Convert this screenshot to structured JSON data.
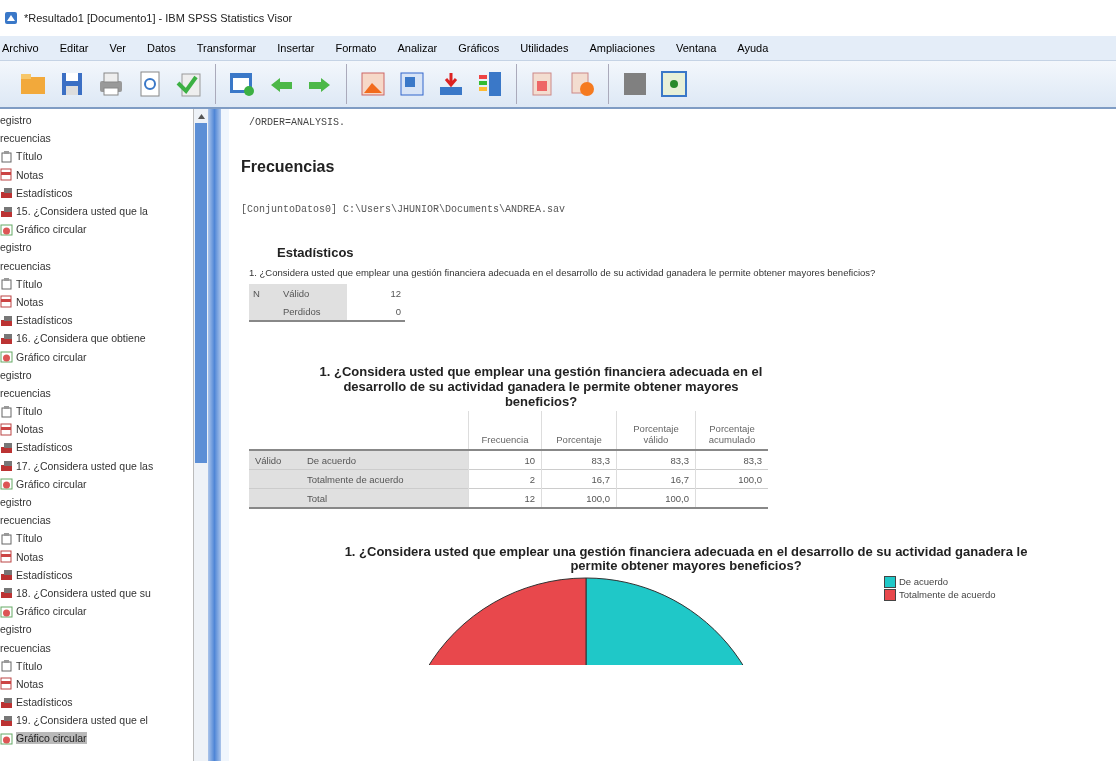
{
  "window": {
    "title": "*Resultado1 [Documento1] - IBM SPSS Statistics Visor"
  },
  "menu": [
    "Archivo",
    "Editar",
    "Ver",
    "Datos",
    "Transformar",
    "Insertar",
    "Formato",
    "Analizar",
    "Gráficos",
    "Utilidades",
    "Ampliaciones",
    "Ventana",
    "Ayuda"
  ],
  "outline": [
    {
      "label": "egistro",
      "selected": false
    },
    {
      "label": "recuencias",
      "selected": false,
      "children": [
        {
          "label": "Título",
          "kind": "title",
          "selected": false
        },
        {
          "label": "Notas",
          "kind": "notes",
          "selected": false
        },
        {
          "label": "Estadísticos",
          "kind": "table",
          "selected": false
        },
        {
          "label": "15. ¿Considera usted que la",
          "kind": "table",
          "selected": false
        },
        {
          "label": "Gráfico circular",
          "kind": "chart",
          "selected": false
        }
      ]
    },
    {
      "label": "egistro",
      "selected": false
    },
    {
      "label": "recuencias",
      "selected": false,
      "children": [
        {
          "label": "Título",
          "kind": "title",
          "selected": false
        },
        {
          "label": "Notas",
          "kind": "notes",
          "selected": false
        },
        {
          "label": "Estadísticos",
          "kind": "table",
          "selected": false
        },
        {
          "label": "16. ¿Considera que obtiene",
          "kind": "table",
          "selected": false
        },
        {
          "label": "Gráfico circular",
          "kind": "chart",
          "selected": false
        }
      ]
    },
    {
      "label": "egistro",
      "selected": false
    },
    {
      "label": "recuencias",
      "selected": false,
      "children": [
        {
          "label": "Título",
          "kind": "title",
          "selected": false
        },
        {
          "label": "Notas",
          "kind": "notes",
          "selected": false
        },
        {
          "label": "Estadísticos",
          "kind": "table",
          "selected": false
        },
        {
          "label": "17. ¿Considera usted que las",
          "kind": "table",
          "selected": false
        },
        {
          "label": "Gráfico circular",
          "kind": "chart",
          "selected": false
        }
      ]
    },
    {
      "label": "egistro",
      "selected": false
    },
    {
      "label": "recuencias",
      "selected": false,
      "children": [
        {
          "label": "Título",
          "kind": "title",
          "selected": false
        },
        {
          "label": "Notas",
          "kind": "notes",
          "selected": false
        },
        {
          "label": "Estadísticos",
          "kind": "table",
          "selected": false
        },
        {
          "label": "18. ¿Considera usted que su",
          "kind": "table",
          "selected": false
        },
        {
          "label": "Gráfico circular",
          "kind": "chart",
          "selected": false
        }
      ]
    },
    {
      "label": "egistro",
      "selected": false
    },
    {
      "label": "recuencias",
      "selected": false,
      "children": [
        {
          "label": "Título",
          "kind": "title",
          "selected": false
        },
        {
          "label": "Notas",
          "kind": "notes",
          "selected": false
        },
        {
          "label": "Estadísticos",
          "kind": "table",
          "selected": false
        },
        {
          "label": "19. ¿Considera usted que el",
          "kind": "table",
          "selected": false
        },
        {
          "label": "Gráfico circular",
          "kind": "chart",
          "selected": true
        }
      ]
    }
  ],
  "output": {
    "syntax": "/ORDER=ANALYSIS.",
    "heading": "Frecuencias",
    "dataset": "[ConjuntoDatos0] C:\\Users\\JHUNIOR\\Documents\\ANDREA.sav",
    "stats": {
      "title": "Estadísticos",
      "caption": "1. ¿Considera usted que emplear una gestión financiera adecuada en el desarrollo de su actividad ganadera le permite obtener mayores beneficios?",
      "rows": [
        [
          "N",
          "Válido",
          "12"
        ],
        [
          "",
          "Perdidos",
          "0"
        ]
      ]
    },
    "freq": {
      "title": "1. ¿Considera usted que emplear una gestión financiera adecuada en el desarrollo de su actividad ganadera le permite obtener mayores beneficios?",
      "columns": [
        "",
        "",
        "Frecuencia",
        "Porcentaje",
        "Porcentaje válido",
        "Porcentaje acumulado"
      ],
      "rows": [
        [
          "Válido",
          "De acuerdo",
          "10",
          "83,3",
          "83,3",
          "83,3"
        ],
        [
          "",
          "Totalmente de acuerdo",
          "2",
          "16,7",
          "16,7",
          "100,0"
        ],
        [
          "",
          "Total",
          "12",
          "100,0",
          "100,0",
          ""
        ]
      ]
    },
    "chart": {
      "title_lines": [
        "1. ¿Considera usted que emplear una gestión financiera adecuada en el desarrollo de su actividad ganadera le",
        "permite obtener mayores beneficios?"
      ],
      "legend": [
        {
          "label": "De acuerdo",
          "color": "#1fc8c8"
        },
        {
          "label": "Totalmente de acuerdo",
          "color": "#e8484c"
        }
      ]
    }
  }
}
